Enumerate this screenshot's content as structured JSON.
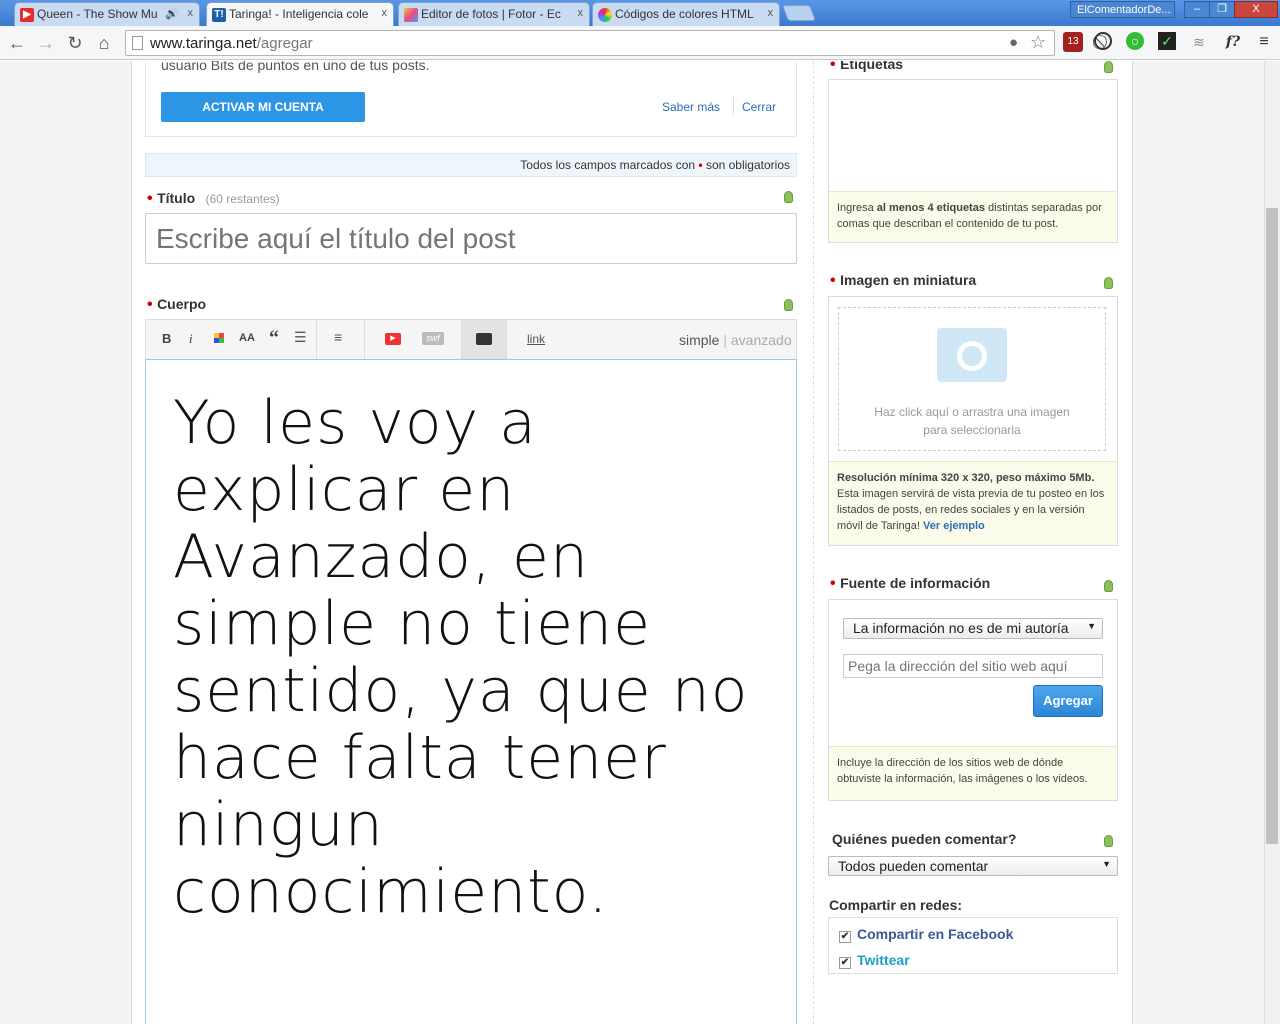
{
  "browser": {
    "tabs": [
      {
        "title": "Queen - The Show Mu",
        "icon": "youtube-icon"
      },
      {
        "title": "Taringa! - Inteligencia cole",
        "icon": "taringa-icon"
      },
      {
        "title": "Editor de fotos | Fotor - Ec",
        "icon": "fotor-icon"
      },
      {
        "title": "Códigos de colores HTML",
        "icon": "color-wheel-icon"
      }
    ],
    "user_button": "ElComentadorDe...",
    "window_controls": [
      "–",
      "❐",
      "X"
    ],
    "url_host": "www.taringa.net",
    "url_path": "/agregar",
    "extension_badge": "13",
    "ext_f_label": "f?"
  },
  "banner": {
    "text": "usuario Bits de puntos en uno de tus posts.",
    "activate_button": "ACTIVAR MI CUENTA",
    "more_link": "Saber más",
    "close_link": "Cerrar"
  },
  "required_note": {
    "before": "Todos los campos marcados con",
    "star": "•",
    "after": "son obligatorios"
  },
  "title_field": {
    "label": "Título",
    "remaining": "(60 restantes)",
    "placeholder": "Escribe aquí el título del post"
  },
  "body_field": {
    "label": "Cuerpo",
    "tools": {
      "bold": "B",
      "italic": "i",
      "size": "AA",
      "quote": "“",
      "swf": "swf",
      "link": "link"
    },
    "mode_simple": "simple",
    "mode_sep": "|",
    "mode_advanced": "avanzado",
    "content": "Yo les voy a explicar en Avanzado, en simple no tiene sentido, ya que no hace falta tener ningun conocimiento."
  },
  "tags": {
    "label": "Etiquetas",
    "info_pre": "Ingresa ",
    "info_bold": "al menos 4 etiquetas",
    "info_post": " distintas separadas por comas que describan el contenido de tu post."
  },
  "thumbnail": {
    "label": "Imagen en miniatura",
    "drop_text_1": "Haz click aquí o arrastra una imagen",
    "drop_text_2": "para seleccionarla",
    "info_bold": "Resolución mínima 320 x 320, peso máximo 5Mb.",
    "info_text": "Esta imagen servirá de vista previa de tu posteo en los listados de posts, en redes sociales y en la versión móvil de Taringa!",
    "info_link": "Ver ejemplo"
  },
  "source": {
    "label": "Fuente de información",
    "select_value": "La información no es de mi autoría",
    "url_placeholder": "Pega la dirección del sitio web aquí",
    "add_button": "Agregar",
    "info": "Incluye la dirección de los sitios web de dónde obtuviste la información, las imágenes o los videos."
  },
  "comments": {
    "label": "Quiénes pueden comentar?",
    "select_value": "Todos pueden comentar"
  },
  "share": {
    "label": "Compartir en redes:",
    "facebook": "Compartir en Facebook",
    "twitter": "Twittear"
  },
  "colors": {
    "accent_blue": "#2d95e6",
    "chrome_blue": "#3a78cf",
    "required_red": "#cc0000",
    "facebook_blue": "#3b5998",
    "twitter_blue": "#1da1c9",
    "info_yellow": "#fbfbe9"
  }
}
